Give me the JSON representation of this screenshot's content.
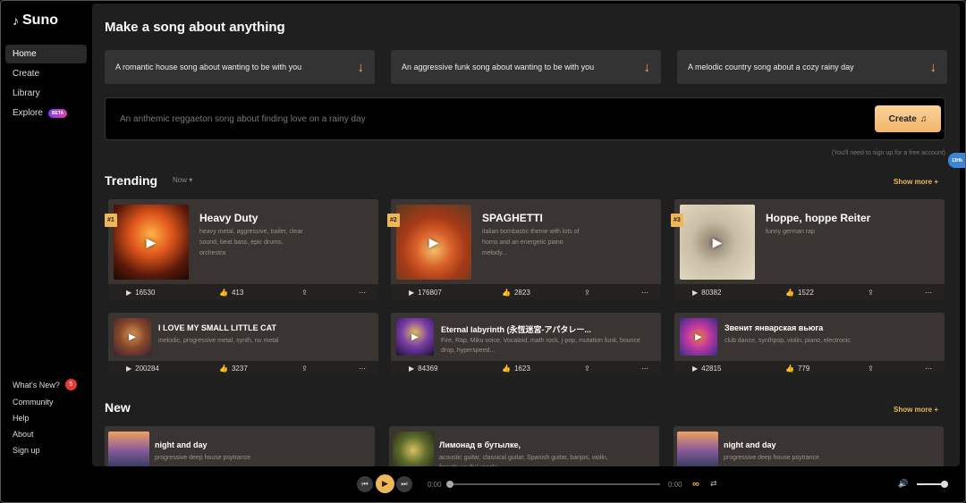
{
  "app": {
    "name": "Suno"
  },
  "sidebar": {
    "items": [
      {
        "label": "Home"
      },
      {
        "label": "Create"
      },
      {
        "label": "Library"
      },
      {
        "label": "Explore",
        "badge": "BETA"
      }
    ],
    "bottom_items": [
      {
        "label": "What's New?",
        "badge": "5"
      },
      {
        "label": "Community"
      },
      {
        "label": "Help"
      },
      {
        "label": "About"
      },
      {
        "label": "Sign up"
      }
    ]
  },
  "main": {
    "title": "Make a song about anything",
    "prompts": [
      "A romantic house song about wanting to be with you",
      "An aggressive funk song about wanting to be with you",
      "A melodic country song about a cozy rainy day"
    ],
    "create_placeholder": "An anthemic reggaeton song about finding love on a rainy day",
    "create_label": "Create",
    "signup_note": "(You'll need to sign up for a free account)",
    "side_pill": "13Hb"
  },
  "trending": {
    "title": "Trending",
    "filter": "Now",
    "show_more": "Show more +",
    "big": [
      {
        "rank": "#1",
        "title": "Heavy Duty",
        "tags": "heavy metal, aggressive, trailer, clear sound, beat bass, epic drums, orchestra",
        "plays": "16530",
        "likes": "413"
      },
      {
        "rank": "#2",
        "title": "SPAGHETTI",
        "tags": "italian bombastic theme with lots of horns and an energetic piano melody...",
        "plays": "176807",
        "likes": "2823"
      },
      {
        "rank": "#3",
        "title": "Hoppe, hoppe Reiter",
        "tags": "funny german rap",
        "plays": "80382",
        "likes": "1522"
      }
    ],
    "small": [
      {
        "title": "I LOVE MY SMALL LITTLE CAT",
        "tags": "melodic, progressive metal, synth, nu metal",
        "plays": "200284",
        "likes": "3237"
      },
      {
        "title": "Eternal labyrinth (永恆迷宮-アパタレー...",
        "tags": "Fire, Rap, Miku voice, Vocaloid, math rock, j-pop, mutation funk, bounce drop, hyperspeed...",
        "plays": "84369",
        "likes": "1623"
      },
      {
        "title": "Звенит январская вьюга",
        "tags": "club dance, synthpop, violin, piano, electronic",
        "plays": "42815",
        "likes": "779"
      }
    ]
  },
  "new": {
    "title": "New",
    "show_more": "Show more +",
    "items": [
      {
        "title": "night and day",
        "tags": "progressive deep house psytrance"
      },
      {
        "title": "Лимонад в бутылке,",
        "tags": "acoustic guitar, classical guitar, Spanish guitar, banjos, violin, female soulful vocals"
      },
      {
        "title": "night and day",
        "tags": "progressive deep house psytrance"
      }
    ]
  },
  "player": {
    "time_start": "0:00",
    "time_end": "0:00"
  },
  "colors": {
    "accent": "#f0b65a",
    "card": "#3a3532",
    "panel": "#1f1f1f"
  },
  "icons": [
    "suno-logo-icon",
    "arrow-down-icon",
    "music-note-icon",
    "play-icon",
    "like-icon",
    "share-icon",
    "more-icon",
    "prev-icon",
    "next-icon",
    "loop-icon",
    "shuffle-icon",
    "volume-icon"
  ]
}
